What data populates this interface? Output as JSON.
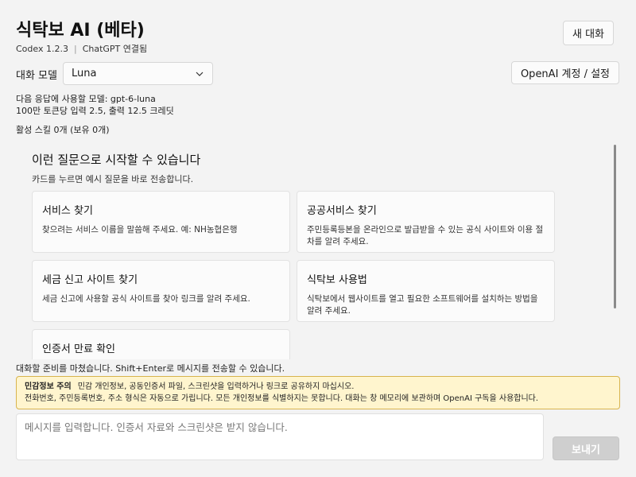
{
  "header": {
    "title": "식탁보 AI (베타)",
    "version": "Codex 1.2.3",
    "separator": "|",
    "connection": "ChatGPT 연결됨",
    "new_chat_label": "새 대화"
  },
  "model": {
    "label": "대화 모델",
    "selected": "Luna",
    "account_button": "OpenAI 계정 / 설정"
  },
  "info": {
    "next_model": "다음 응답에 사용할 모델: gpt-6-luna",
    "pricing": "100만 토큰당 입력 2.5, 출력 12.5 크레딧",
    "skills": "활성 스킬 0개 (보유 0개)"
  },
  "suggestions": {
    "title": "이런 질문으로 시작할 수 있습니다",
    "subtitle": "카드를 누르면 예시 질문을 바로 전송합니다.",
    "cards": [
      {
        "title": "서비스 찾기",
        "desc": "찾으려는 서비스 이름을 말씀해 주세요. 예: NH농협은행"
      },
      {
        "title": "공공서비스 찾기",
        "desc": "주민등록등본을 온라인으로 발급받을 수 있는 공식 사이트와 이용 절차를 알려 주세요."
      },
      {
        "title": "세금 신고 사이트 찾기",
        "desc": "세금 신고에 사용할 공식 사이트를 찾아 링크를 알려 주세요."
      },
      {
        "title": "식탁보 사용법",
        "desc": "식탁보에서 웹사이트를 열고 필요한 소프트웨어를 설치하는 방법을 알려 주세요."
      },
      {
        "title": "인증서 만료 확인",
        "desc": ""
      }
    ]
  },
  "status": "대화할 준비를 마쳤습니다. Shift+Enter로 메시지를 전송할 수 있습니다.",
  "warning": {
    "heading": "민감정보 주의",
    "line1": "민감 개인정보, 공동인증서 파일, 스크린샷을 입력하거나 링크로 공유하지 마십시오.",
    "line2": "전화번호, 주민등록번호, 주소 형식은 자동으로 가립니다. 모든 개인정보를 식별하지는 못합니다. 대화는 창 메모리에 보관하며 OpenAI 구독을 사용합니다."
  },
  "composer": {
    "placeholder": "메시지를 입력합니다. 인증서 자료와 스크린샷은 받지 않습니다.",
    "send_label": "보내기"
  },
  "icons": {
    "dropdown": "chevron-down-icon"
  },
  "colors": {
    "background": "#f3f3f3",
    "warning_bg": "#fff5ce",
    "warning_border": "#d8b44e",
    "send_disabled": "#cfcfcf"
  }
}
